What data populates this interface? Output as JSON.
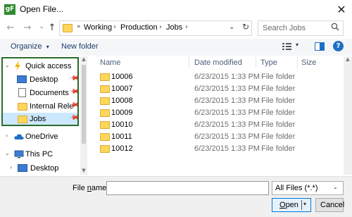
{
  "window": {
    "icon_text": "gF",
    "title": "Open File...",
    "close_glyph": "✕"
  },
  "address": {
    "back_glyph": "←",
    "forward_glyph": "→",
    "recent_glyph": "⌄",
    "up_glyph": "↑",
    "overflow": "«",
    "crumbs": [
      "Working",
      "Production",
      "Jobs"
    ],
    "separator": "›",
    "dropdown_glyph": "⌄",
    "refresh_glyph": "↻"
  },
  "search": {
    "placeholder": "Search Jobs",
    "icon": "search-icon"
  },
  "toolbar": {
    "organize_label": "Organize",
    "organize_arrow": "▾",
    "new_folder_label": "New folder",
    "view_dropdown": "▾",
    "help_glyph": "?"
  },
  "nav": {
    "quick_access": {
      "chevron": "⌄",
      "label": "Quick access",
      "items": [
        {
          "label": "Desktop",
          "icon": "desktop-icon",
          "pinned": true
        },
        {
          "label": "Documents",
          "icon": "documents-icon",
          "pinned": true
        },
        {
          "label": "Internal Relea",
          "icon": "folder-icon",
          "pinned": true
        },
        {
          "label": "Jobs",
          "icon": "folder-icon",
          "pinned": true,
          "selected": true
        }
      ]
    },
    "onedrive": {
      "chevron": "›",
      "label": "OneDrive"
    },
    "this_pc": {
      "chevron": "⌄",
      "label": "This PC"
    },
    "this_pc_desktop": {
      "chevron": "›",
      "label": "Desktop"
    },
    "pin_glyph": "📌"
  },
  "columns": {
    "name": "Name",
    "date": "Date modified",
    "type": "Type",
    "size": "Size"
  },
  "files": [
    {
      "name": "10006",
      "date": "6/23/2015 1:33 PM",
      "type": "File folder"
    },
    {
      "name": "10007",
      "date": "6/23/2015 1:33 PM",
      "type": "File folder"
    },
    {
      "name": "10008",
      "date": "6/23/2015 1:33 PM",
      "type": "File folder"
    },
    {
      "name": "10009",
      "date": "6/23/2015 1:33 PM",
      "type": "File folder"
    },
    {
      "name": "10010",
      "date": "6/23/2015 1:33 PM",
      "type": "File folder"
    },
    {
      "name": "10011",
      "date": "6/23/2015 1:33 PM",
      "type": "File folder"
    },
    {
      "name": "10012",
      "date": "6/23/2015 1:33 PM",
      "type": "File folder"
    }
  ],
  "footer": {
    "file_name_label_pre": "File ",
    "file_name_label_u": "n",
    "file_name_label_post": "ame:",
    "file_name_value": "",
    "file_type": "All Files (*.*)",
    "open_pre": "",
    "open_u": "O",
    "open_post": "pen",
    "cancel": "Cancel"
  },
  "colors": {
    "accent": "#0078d7",
    "selection": "#cce8ff",
    "highlight_border": "#2b6b2b",
    "folder": "#fdd65a"
  }
}
